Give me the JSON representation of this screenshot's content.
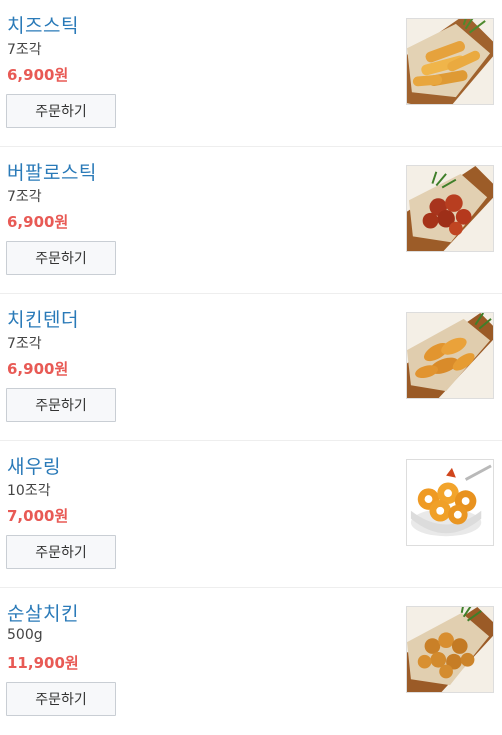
{
  "items": [
    {
      "name": "치즈스틱",
      "quantity": "7조각",
      "price": "6,900원",
      "button_label": "주문하기",
      "image": "cheese-stick-photo"
    },
    {
      "name": "버팔로스틱",
      "quantity": "7조각",
      "price": "6,900원",
      "button_label": "주문하기",
      "image": "buffalo-stick-photo"
    },
    {
      "name": "치킨텐더",
      "quantity": "7조각",
      "price": "6,900원",
      "button_label": "주문하기",
      "image": "chicken-tender-photo"
    },
    {
      "name": "새우링",
      "quantity": "10조각",
      "price": "7,000원",
      "button_label": "주문하기",
      "image": "shrimp-ring-photo"
    },
    {
      "name": "순살치킨",
      "quantity": "500g",
      "price": "11,900원",
      "button_label": "주문하기",
      "image": "boneless-chicken-photo"
    }
  ],
  "colors": {
    "name": "#2a7ab8",
    "price": "#e85a55",
    "button_bg": "#f7f8fa",
    "button_border": "#c9ced4"
  }
}
